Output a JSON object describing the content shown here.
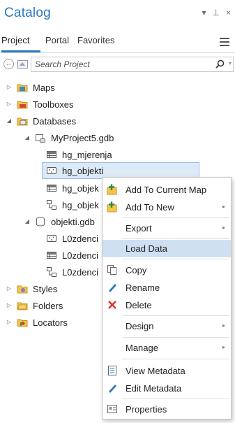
{
  "pane": {
    "title": "Catalog",
    "controls": [
      "▾",
      "⊥",
      "×"
    ]
  },
  "tabs": [
    {
      "label": "Project",
      "active": true
    },
    {
      "label": "Portal",
      "active": false
    },
    {
      "label": "Favorites",
      "active": false
    }
  ],
  "search": {
    "placeholder": "Search Project"
  },
  "tree": [
    {
      "label": "Maps",
      "icon": "maps-folder-icon",
      "expanded": false
    },
    {
      "label": "Toolboxes",
      "icon": "toolbox-folder-icon",
      "expanded": false
    },
    {
      "label": "Databases",
      "icon": "databases-folder-icon",
      "expanded": true
    },
    {
      "label": "MyProject5.gdb",
      "icon": "geodatabase-icon",
      "expanded": true
    },
    {
      "label": "hg_mjerenja",
      "icon": "table-icon"
    },
    {
      "label": "hg_objekti",
      "icon": "point-feature-class-icon",
      "selected": true
    },
    {
      "label": "hg_objek",
      "icon": "table-icon"
    },
    {
      "label": "hg_objek",
      "icon": "relationship-class-icon"
    },
    {
      "label": "objekti.gdb",
      "icon": "database-icon",
      "expanded": true
    },
    {
      "label": "L0zdenci",
      "icon": "point-feature-class-icon"
    },
    {
      "label": "L0zdenci",
      "icon": "table-icon"
    },
    {
      "label": "L0zdenci",
      "icon": "relationship-class-icon"
    },
    {
      "label": "Styles",
      "icon": "styles-folder-icon",
      "expanded": false
    },
    {
      "label": "Folders",
      "icon": "folders-icon",
      "expanded": false
    },
    {
      "label": "Locators",
      "icon": "locators-icon",
      "expanded": false
    }
  ],
  "context_menu": {
    "items": [
      {
        "label": "Add To Current Map",
        "icon": "add-data-icon",
        "submenu": false
      },
      {
        "label": "Add To New",
        "icon": "add-data-icon",
        "submenu": true
      },
      {
        "label": "Export",
        "icon": "",
        "submenu": true
      },
      {
        "label": "Load Data",
        "icon": "",
        "submenu": false,
        "highlighted": true
      },
      {
        "label": "Copy",
        "icon": "copy-icon",
        "submenu": false
      },
      {
        "label": "Rename",
        "icon": "rename-pencil-icon",
        "submenu": false
      },
      {
        "label": "Delete",
        "icon": "delete-x-icon",
        "submenu": false
      },
      {
        "label": "Design",
        "icon": "",
        "submenu": true
      },
      {
        "label": "Manage",
        "icon": "",
        "submenu": true
      },
      {
        "label": "View Metadata",
        "icon": "metadata-icon",
        "submenu": false
      },
      {
        "label": "Edit Metadata",
        "icon": "edit-metadata-pencil-icon",
        "submenu": false
      },
      {
        "label": "Properties",
        "icon": "properties-icon",
        "submenu": false
      }
    ]
  },
  "colors": {
    "accent": "#2b79c2",
    "selection": "#dce9f7",
    "menu_highlight": "#cfe0f2",
    "delete_red": "#d93025"
  }
}
